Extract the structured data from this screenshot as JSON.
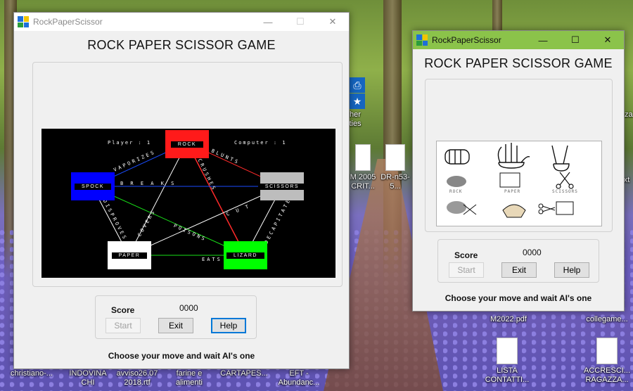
{
  "desktop": {
    "icons": [
      {
        "label": "christiano-..."
      },
      {
        "label": "INDOVINA CHI"
      },
      {
        "label": "avviso26.07 2018.rtf"
      },
      {
        "label": "farine e alimenti"
      },
      {
        "label": "CARTAPES..."
      },
      {
        "label": "EFT - Abundanc..."
      },
      {
        "label": "LISTA CONTATTI..."
      },
      {
        "label": "ACCRESCI... RAGAZZA..."
      },
      {
        "label": "M2022.pdf"
      },
      {
        "label": "collegame..."
      },
      {
        "label": "ther ities"
      },
      {
        "label": "M 2005 CRIT..."
      },
      {
        "label": "DR-n53-5..."
      },
      {
        "label": "xt"
      },
      {
        "label": "zza"
      }
    ]
  },
  "window_main": {
    "title": "RockPaperScissor",
    "game_title": "ROCK PAPER SCISSOR GAME",
    "board": {
      "player_label": "Player : 1",
      "computer_label": "Computer : 1",
      "nodes": {
        "rock": "ROCK",
        "spock": "SPOCK",
        "scissors": "SCISSORS",
        "paper": "PAPER",
        "lizard": "LIZARD"
      },
      "edge_labels": {
        "vaporizes": "VAPORIZES",
        "blunts": "BLUNTS",
        "breaks": "B R E A K S",
        "crushes": "CRUSHES",
        "cuts": "C U T",
        "decapitates": "DECAPITATES",
        "disproves": "DISPROVES",
        "covers": "COVERS",
        "eats": "EATS",
        "poisons": "POISONS"
      }
    },
    "score_label": "Score",
    "score_value": "0000",
    "buttons": {
      "start": "Start",
      "exit": "Exit",
      "help": "Help"
    },
    "status": "Choose your move and wait AI's one"
  },
  "window_second": {
    "title": "RockPaperScissor",
    "game_title": "ROCK PAPER SCISSOR GAME",
    "hand_labels": {
      "rock": "ROCK",
      "paper": "PAPER",
      "scissors": "SCISSORS"
    },
    "score_label": "Score",
    "score_value": "0000",
    "buttons": {
      "start": "Start",
      "exit": "Exit",
      "help": "Help"
    },
    "status": "Choose your move and wait AI's one"
  },
  "colors": {
    "rock": "#ff1a1a",
    "spock": "#0000ff",
    "scissors": "#bdbdbd",
    "paper": "#ffffff",
    "lizard": "#00ff00",
    "active_titlebar": "#8bc34a"
  }
}
